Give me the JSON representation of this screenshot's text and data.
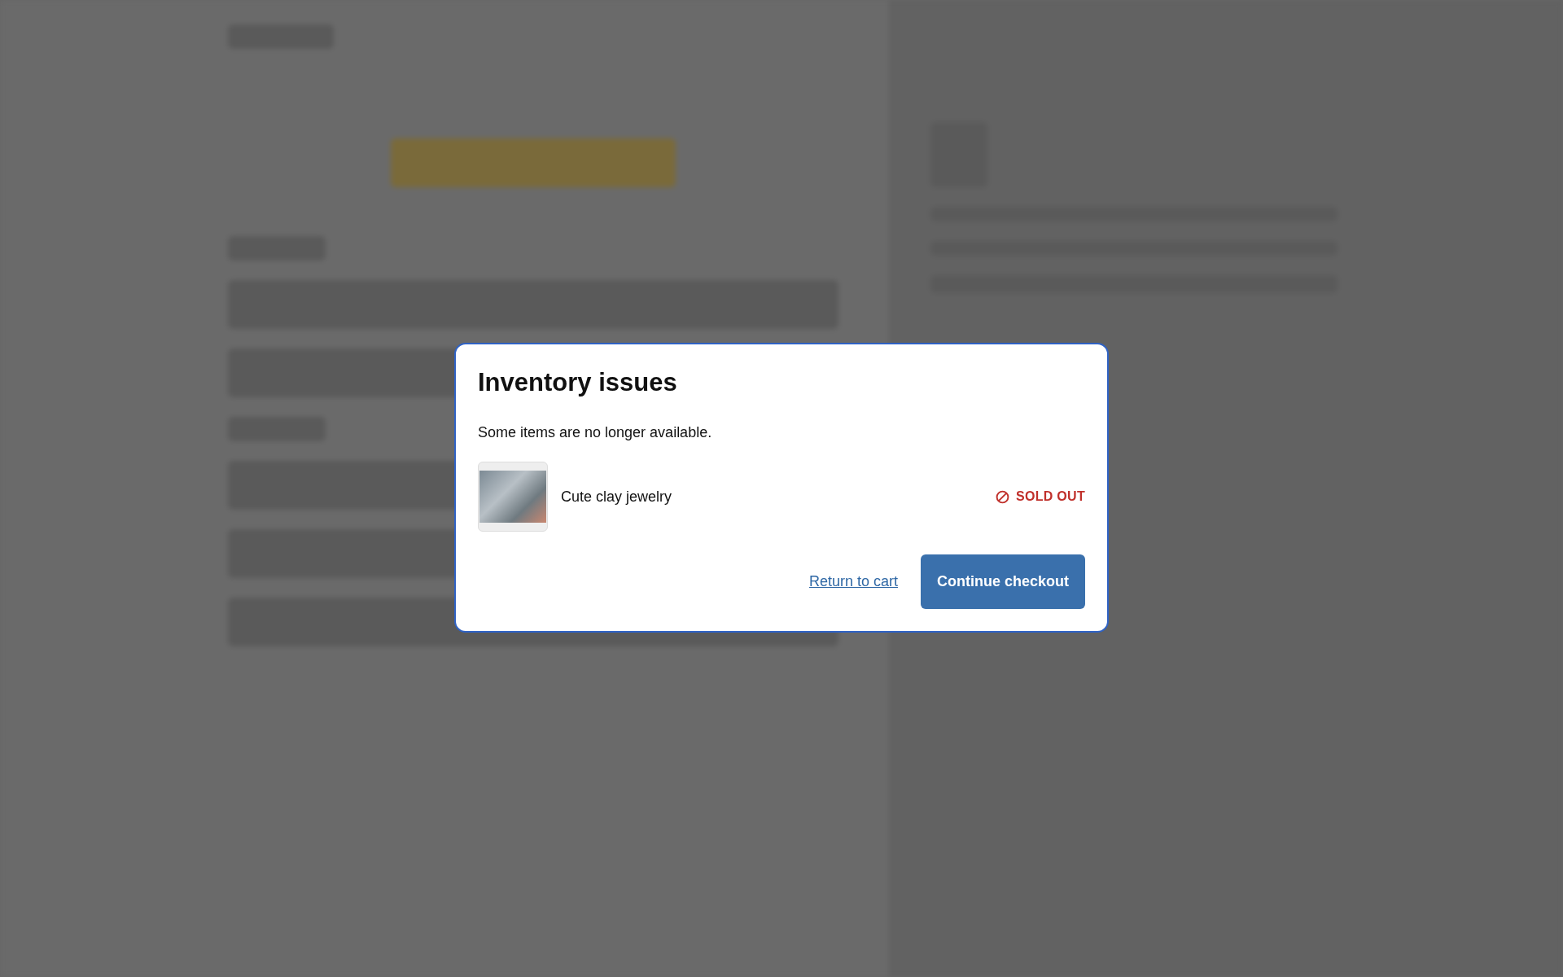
{
  "dialog": {
    "title": "Inventory issues",
    "message": "Some items are no longer available.",
    "items": [
      {
        "name": "Cute clay jewelry",
        "status": "SOLD OUT"
      }
    ],
    "secondary_link": "Return to cart",
    "primary_button": "Continue checkout"
  }
}
